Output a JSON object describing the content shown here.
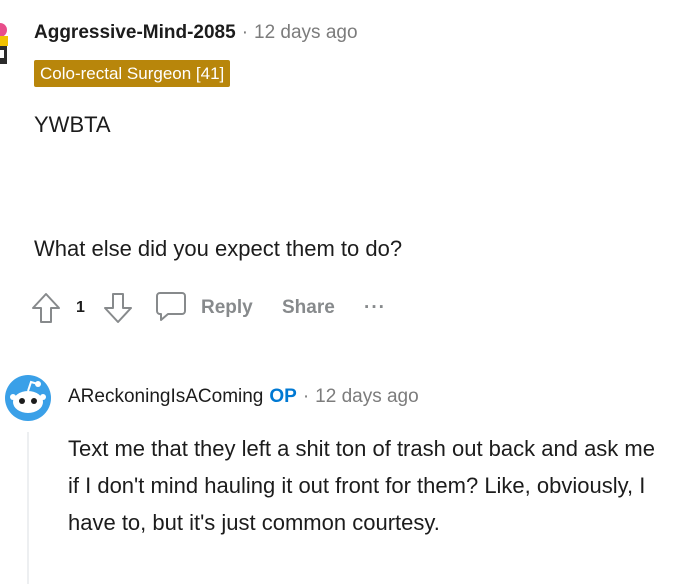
{
  "comment1": {
    "username": "Aggressive-Mind-2085",
    "separator": "·",
    "timestamp": "12 days ago",
    "flair": "Colo-rectal Surgeon [41]",
    "flair_color": "#b8860b",
    "body_line1": "YWBTA",
    "body_line2": "What else did you expect them to do?",
    "actions": {
      "upvote_icon": "upvote-arrow-icon",
      "vote_count": "1",
      "downvote_icon": "downvote-arrow-icon",
      "reply_icon": "speech-bubble-icon",
      "reply_label": "Reply",
      "share_label": "Share",
      "more_label": "···"
    }
  },
  "comment2": {
    "username": "AReckoningIsAComing",
    "op_badge": "OP",
    "op_color": "#0079d3",
    "separator": "·",
    "timestamp": "12 days ago",
    "body": "Text me that they left a shit ton of trash out back and ask me if I don't mind hauling it out front for them? Like, obviously, I have to, but it's just common courtesy."
  }
}
